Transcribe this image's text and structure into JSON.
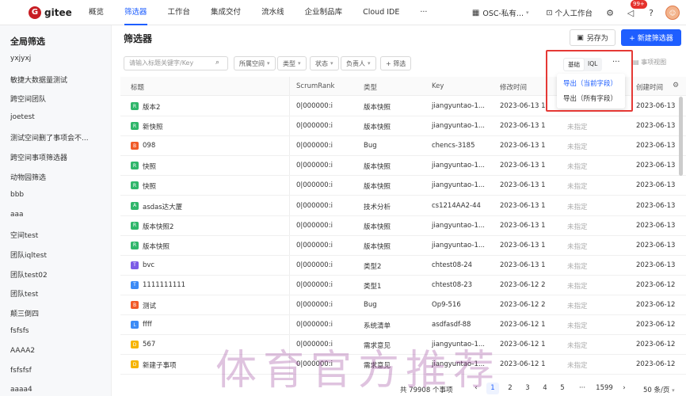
{
  "brand": {
    "logo_letter": "G",
    "name": "gitee"
  },
  "nav": [
    "概览",
    "筛选器",
    "工作台",
    "集成交付",
    "流水线",
    "企业制品库",
    "Cloud IDE",
    "···"
  ],
  "nav_active": 1,
  "top_right": {
    "org": "OSC-私有...",
    "workbench": "个人工作台",
    "notify_badge": "99+"
  },
  "sidebar": {
    "title": "全局筛选",
    "items": [
      "yxjyxj",
      "敏捷大数据量测试",
      "跨空间团队",
      "joetest",
      "测试空间删了事项会不...",
      "跨空间事项筛选器",
      "动物园筛选",
      "bbb",
      "aaa",
      "空间test",
      "团队iqltest",
      "团队test02",
      "团队test",
      "颠三倒四",
      "fsfsfs",
      "AAAA2",
      "fsfsfsf",
      "aaaa4"
    ]
  },
  "main": {
    "title": "筛选器",
    "save_as": "另存为",
    "new_filter": "+ 新建筛选器",
    "search_placeholder": "请输入标题关键字/Key",
    "filters": [
      "所属空间",
      "类型",
      "状态",
      "负责人"
    ],
    "add_filter": "+ 筛选"
  },
  "popover": {
    "toggle_basic": "基础",
    "toggle_iql": "IQL",
    "more": "···",
    "export_current": "导出（当前字段）",
    "export_all": "导出（所有字段）",
    "view_label": "事项视图"
  },
  "table": {
    "headers": [
      "标题",
      "ScrumRank",
      "类型",
      "Key",
      "修改时间",
      "创建时间"
    ],
    "rows": [
      {
        "title": "版本2",
        "rank": "0|000000:i",
        "type": "版本快照",
        "key": "jiangyuntao-1...",
        "mtime": "2023-06-13 1",
        "owner": "",
        "ctime": "2023-06-13",
        "color": "#2fb66a",
        "glyph": "R"
      },
      {
        "title": "新快照",
        "rank": "0|000000:i",
        "type": "版本快照",
        "key": "jiangyuntao-1...",
        "mtime": "2023-06-13 1",
        "owner": "未指定",
        "ctime": "2023-06-13",
        "color": "#2fb66a",
        "glyph": "R"
      },
      {
        "title": "098",
        "rank": "0|000000:i",
        "type": "Bug",
        "key": "chencs-3185",
        "mtime": "2023-06-13 1",
        "owner": "未指定",
        "ctime": "2023-06-13",
        "color": "#f05a28",
        "glyph": "B"
      },
      {
        "title": "快照",
        "rank": "0|000000:i",
        "type": "版本快照",
        "key": "jiangyuntao-1...",
        "mtime": "2023-06-13 1",
        "owner": "未指定",
        "ctime": "2023-06-13",
        "color": "#2fb66a",
        "glyph": "R"
      },
      {
        "title": "快照",
        "rank": "0|000000:i",
        "type": "版本快照",
        "key": "jiangyuntao-1...",
        "mtime": "2023-06-13 1",
        "owner": "未指定",
        "ctime": "2023-06-13",
        "color": "#2fb66a",
        "glyph": "R"
      },
      {
        "title": "asdas达大厦",
        "rank": "0|000000:i",
        "type": "技术分析",
        "key": "cs1214AA2-44",
        "mtime": "2023-06-13 1",
        "owner": "未指定",
        "ctime": "2023-06-13",
        "color": "#2fb66a",
        "glyph": "A"
      },
      {
        "title": "版本快照2",
        "rank": "0|000000:i",
        "type": "版本快照",
        "key": "jiangyuntao-1...",
        "mtime": "2023-06-13 1",
        "owner": "未指定",
        "ctime": "2023-06-13",
        "color": "#2fb66a",
        "glyph": "R"
      },
      {
        "title": "版本快照",
        "rank": "0|000000:i",
        "type": "版本快照",
        "key": "jiangyuntao-1...",
        "mtime": "2023-06-13 1",
        "owner": "未指定",
        "ctime": "2023-06-13",
        "color": "#2fb66a",
        "glyph": "R"
      },
      {
        "title": "bvc",
        "rank": "0|000000:i",
        "type": "类型2",
        "key": "chtest08-24",
        "mtime": "2023-06-13 1",
        "owner": "未指定",
        "ctime": "2023-06-13",
        "color": "#7c5ce6",
        "glyph": "T"
      },
      {
        "title": "1111111111",
        "rank": "0|000000:i",
        "type": "类型1",
        "key": "chtest08-23",
        "mtime": "2023-06-12 2",
        "owner": "未指定",
        "ctime": "2023-06-12",
        "color": "#3d8bf5",
        "glyph": "T"
      },
      {
        "title": "测试",
        "rank": "0|000000:i",
        "type": "Bug",
        "key": "Op9-516",
        "mtime": "2023-06-12 2",
        "owner": "未指定",
        "ctime": "2023-06-12",
        "color": "#f05a28",
        "glyph": "B"
      },
      {
        "title": "ffff",
        "rank": "0|000000:i",
        "type": "系统清单",
        "key": "asdfasdf-88",
        "mtime": "2023-06-12 1",
        "owner": "未指定",
        "ctime": "2023-06-12",
        "color": "#3d8bf5",
        "glyph": "L"
      },
      {
        "title": "567",
        "rank": "0|000000:i",
        "type": "需求意见",
        "key": "jiangyuntao-1...",
        "mtime": "2023-06-12 1",
        "owner": "未指定",
        "ctime": "2023-06-12",
        "color": "#f5b400",
        "glyph": "D"
      },
      {
        "title": "新建子事项",
        "rank": "0|000000:i",
        "type": "需求意见",
        "key": "jiangyuntao-1...",
        "mtime": "2023-06-12 1",
        "owner": "未指定",
        "ctime": "2023-06-12",
        "color": "#f5b400",
        "glyph": "D"
      }
    ]
  },
  "pagination": {
    "total": "共 79908 个事项",
    "pages": [
      "1",
      "2",
      "3",
      "4",
      "5",
      "···",
      "1599"
    ],
    "page_size": "50 条/页"
  },
  "watermark": "体育官方推荐",
  "colors": {
    "accent": "#1e5eff",
    "brand": "#c71d23",
    "highlight_box": "#e53935"
  }
}
